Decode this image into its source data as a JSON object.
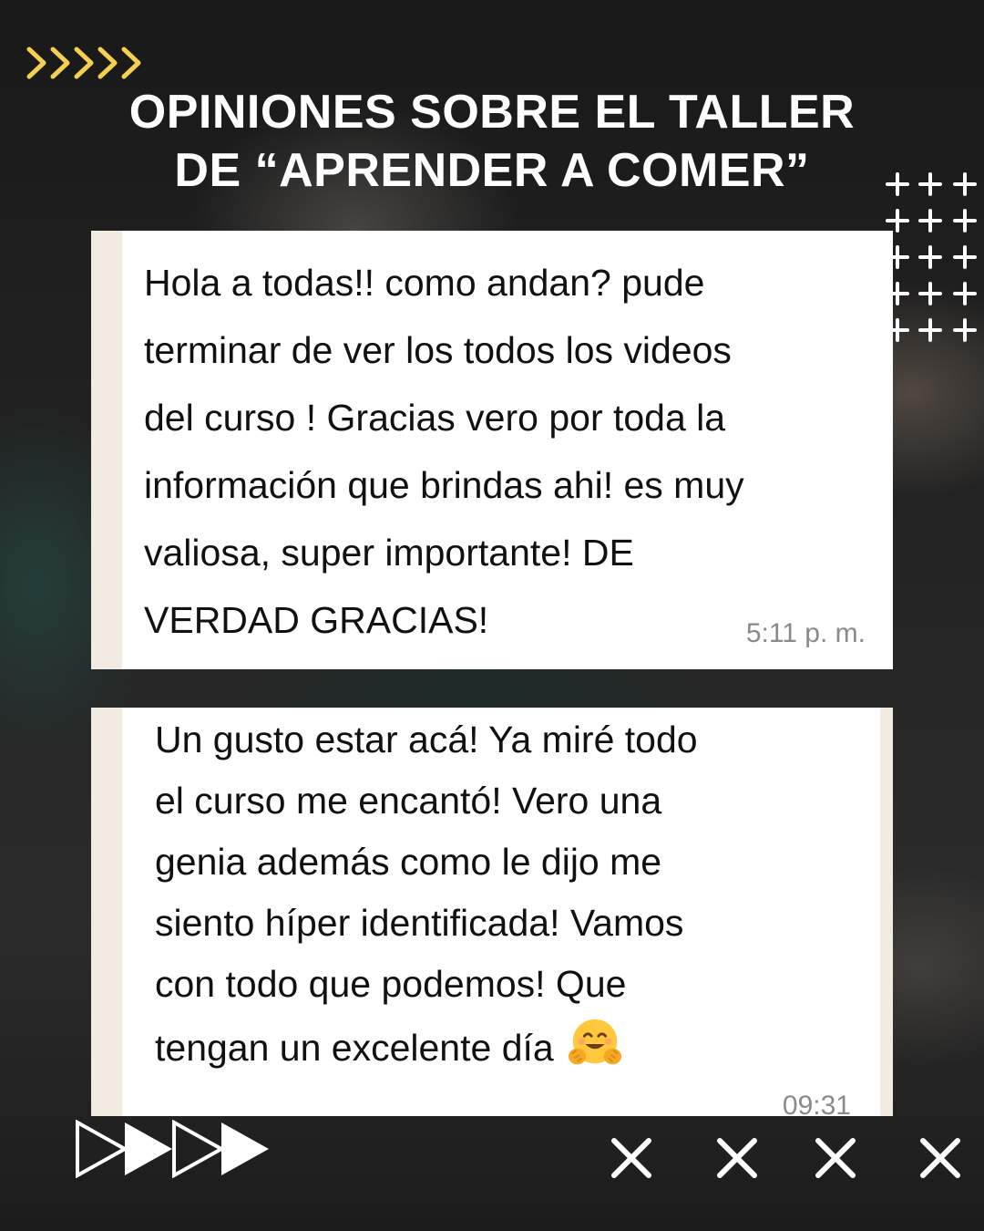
{
  "header": {
    "title_line1": "OPINIONES SOBRE EL TALLER",
    "title_line2": "DE “APRENDER A COMER”"
  },
  "colors": {
    "accent_yellow": "#f5cf4f",
    "text_white": "#ffffff",
    "bubble_bg": "#ffffff",
    "timestamp_gray": "#8a8a8a"
  },
  "decor": {
    "top_left_icon": "chevrons-right-icon",
    "top_right_pattern": "plus-grid-icon",
    "bottom_left_icons": [
      "play-outline-icon",
      "play-solid-icon",
      "play-outline-icon",
      "play-solid-icon"
    ],
    "bottom_right_icons": [
      "close-icon",
      "close-icon",
      "close-icon",
      "close-icon"
    ]
  },
  "messages": [
    {
      "lines": [
        "Hola a todas!! como andan? pude",
        "terminar de ver los todos los videos",
        "del curso ! Gracias vero por toda la",
        "información que brindas ahi! es muy",
        "valiosa, super importante! DE",
        "VERDAD GRACIAS!"
      ],
      "time": "5:11 p. m."
    },
    {
      "lines": [
        "Un gusto estar acá! Ya miré todo",
        "el curso me encantó! Vero una",
        "genia además como le dijo me",
        "siento híper identificada! Vamos",
        "con todo que podemos! Que",
        "tengan un excelente día"
      ],
      "emoji": "hugging-face-icon",
      "time": "09:31"
    }
  ]
}
